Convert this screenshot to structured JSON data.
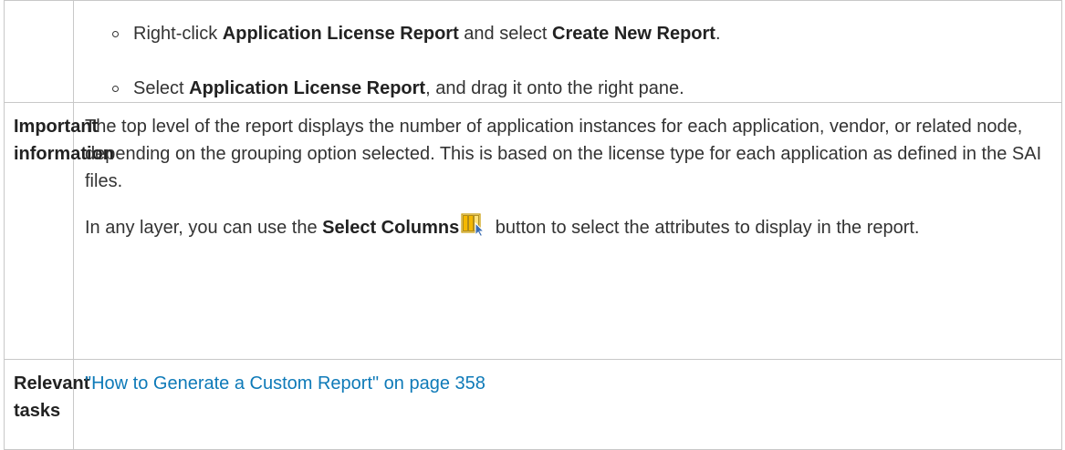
{
  "rows": [
    {
      "label": "",
      "bullets": [
        {
          "t1": "Right-click ",
          "b1": "Application License Report",
          "t2": " and select ",
          "b2": "Create New Report",
          "t3": "."
        },
        {
          "t1": "Select ",
          "b1": "Application License Report",
          "t2": ", and drag it onto the right pane."
        }
      ]
    },
    {
      "label": "Important information",
      "para1": "The top level of the report displays the number of application instances for each application, vendor, or related node, depending on the grouping option selected. This is based on the license type for each application as defined in the SAI files.",
      "para2": {
        "t1": "In any layer, you can use the ",
        "b1": "Select Columns",
        "icon": "select-columns-icon",
        "t2": " button to select the attributes to display in the report."
      }
    },
    {
      "label": "Relevant tasks",
      "link": "\"How to Generate a Custom Report\" on page 358"
    }
  ],
  "colors": {
    "text": "#333333",
    "link": "#0e7ab8",
    "border": "#c8c8c8",
    "icon_accent": "#f5b800"
  }
}
